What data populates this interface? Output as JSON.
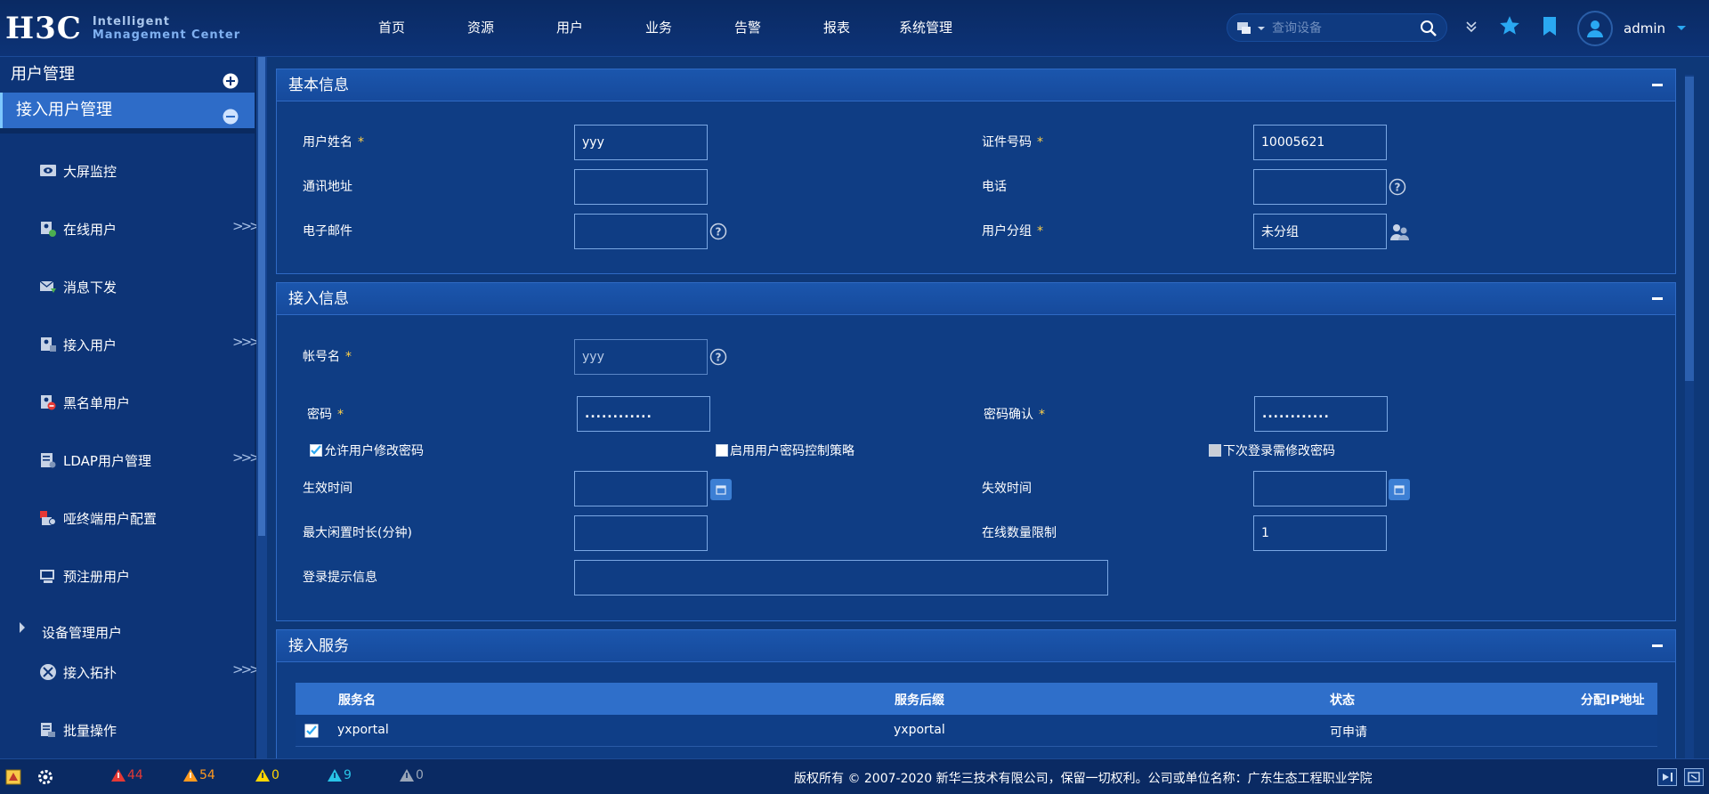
{
  "brand": {
    "mark": "H3C",
    "line1": "Intelligent",
    "line2": "Management Center"
  },
  "nav": [
    "首页",
    "资源",
    "用户",
    "业务",
    "告警",
    "报表",
    "系统管理"
  ],
  "search": {
    "placeholder": "查询设备"
  },
  "user": {
    "name": "admin"
  },
  "sidebar": {
    "section": "用户管理",
    "subsection": "接入用户管理",
    "items": [
      {
        "label": "大屏监控",
        "icon": "monitor-icon",
        "more": ""
      },
      {
        "label": "在线用户",
        "icon": "online-user-icon",
        "more": ">>>"
      },
      {
        "label": "消息下发",
        "icon": "message-icon",
        "more": ""
      },
      {
        "label": "接入用户",
        "icon": "access-user-icon",
        "more": ">>>"
      },
      {
        "label": "黑名单用户",
        "icon": "blacklist-icon",
        "more": ""
      },
      {
        "label": "LDAP用户管理",
        "icon": "ldap-icon",
        "more": ">>>"
      },
      {
        "label": "哑终端用户配置",
        "icon": "dumb-terminal-icon",
        "more": ""
      },
      {
        "label": "预注册用户",
        "icon": "preregister-icon",
        "more": ""
      },
      {
        "label": "设备管理用户",
        "icon": "expand-arrow-icon",
        "more": ""
      },
      {
        "label": "接入拓扑",
        "icon": "topology-icon",
        "more": ">>>"
      },
      {
        "label": "批量操作",
        "icon": "batch-icon",
        "more": ""
      }
    ]
  },
  "basic": {
    "title": "基本信息",
    "name_label": "用户姓名",
    "name_value": "yyy",
    "id_label": "证件号码",
    "id_value": "10005621",
    "address_label": "通讯地址",
    "address_value": "",
    "phone_label": "电话",
    "phone_value": "",
    "email_label": "电子邮件",
    "email_value": "",
    "group_label": "用户分组",
    "group_value": "未分组",
    "required_mark": "*"
  },
  "access": {
    "title": "接入信息",
    "account_label": "帐号名",
    "account_value": "yyy",
    "password_label": "密码",
    "password_value": "............",
    "confirm_label": "密码确认",
    "confirm_value": "............",
    "allow_change_label": "允许用户修改密码",
    "allow_change_checked": true,
    "policy_label": "启用用户密码控制策略",
    "policy_checked": false,
    "next_login_label": "下次登录需修改密码",
    "next_login_checked": false,
    "effective_label": "生效时间",
    "effective_value": "",
    "expire_label": "失效时间",
    "expire_value": "",
    "idle_label": "最大闲置时长(分钟)",
    "idle_value": "",
    "online_limit_label": "在线数量限制",
    "online_limit_value": "1",
    "login_tip_label": "登录提示信息",
    "login_tip_value": ""
  },
  "services": {
    "title": "接入服务",
    "columns": [
      "服务名",
      "服务后缀",
      "状态",
      "分配IP地址"
    ],
    "rows": [
      {
        "name": "yxportal",
        "suffix": "yxportal",
        "status": "可申请",
        "ip": "",
        "checked": true
      }
    ]
  },
  "footer": {
    "alarms": [
      {
        "level": "critical",
        "count": "44",
        "color": "#e53935"
      },
      {
        "level": "major",
        "count": "54",
        "color": "#ff9a1f"
      },
      {
        "level": "minor",
        "count": "0",
        "color": "#ffd600"
      },
      {
        "level": "warning",
        "count": "9",
        "color": "#29c4e8"
      },
      {
        "level": "unknown",
        "count": "0",
        "color": "#9aa6b8"
      }
    ],
    "copyright": "版权所有 © 2007-2020 新华三技术有限公司，保留一切权利。公司或单位名称：广东生态工程职业学院"
  },
  "colors": {
    "accent": "#2e6cc8",
    "required": "#ffd24a",
    "panel": "#0f3d84"
  }
}
